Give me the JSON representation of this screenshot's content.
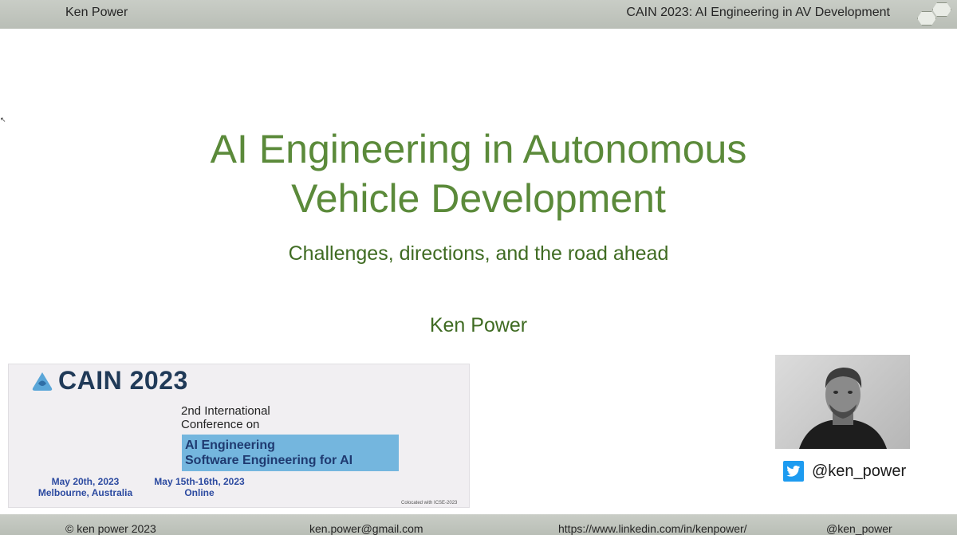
{
  "header": {
    "presenter": "Ken Power",
    "deck_title": "CAIN 2023: AI Engineering in AV Development"
  },
  "slide": {
    "title_line1": "AI Engineering in Autonomous",
    "title_line2": "Vehicle Development",
    "subtitle": "Challenges, directions, and the road ahead",
    "presenter": "Ken Power"
  },
  "conference": {
    "logo_text": "CAIN 2023",
    "edition_line1": "2nd International",
    "edition_line2": "Conference on",
    "topic_line1": "AI Engineering",
    "topic_line2": "Software Engineering for AI",
    "venue1_date": "May 20th, 2023",
    "venue1_place": "Melbourne, Australia",
    "venue2_date": "May 15th-16th, 2023",
    "venue2_place": "Online",
    "colocated": "Colocated with ICSE-2023"
  },
  "speaker": {
    "twitter_handle": "@ken_power",
    "twitter_icon": "twitter-bird-icon"
  },
  "footer": {
    "copyright": "© ken power 2023",
    "email": "ken.power@gmail.com",
    "linkedin": "https://www.linkedin.com/in/kenpower/",
    "twitter": "@ken_power"
  },
  "colors": {
    "title_green": "#5b8a3a",
    "subtitle_green": "#3f6b22",
    "bar_gray": "#c3c8c0",
    "topic_box_blue": "#74b6de",
    "cain_navy": "#203a58",
    "twitter_blue": "#1d9bf0"
  }
}
